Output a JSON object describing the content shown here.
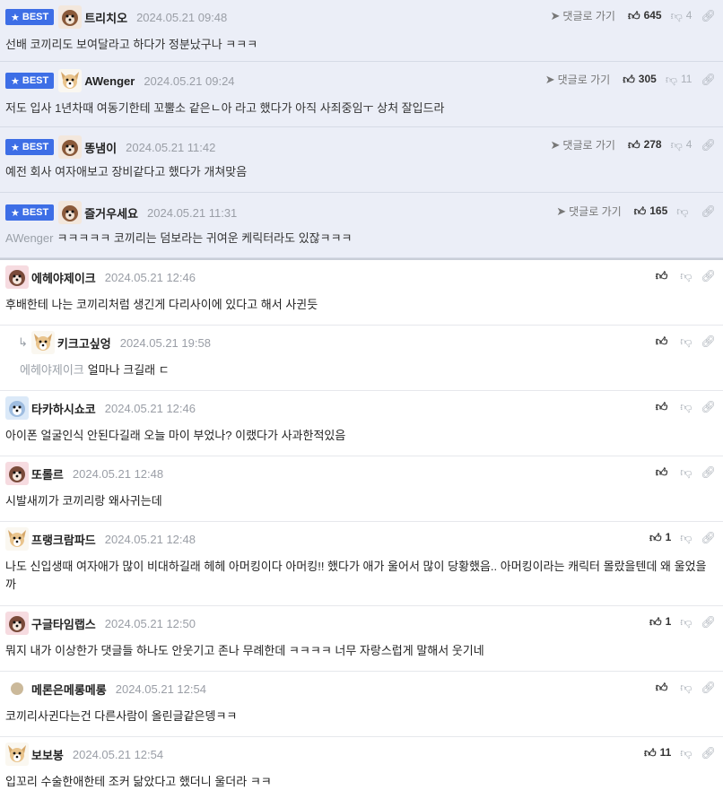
{
  "best_badge": "BEST",
  "goto_label": "댓글로 가기",
  "best_comments": [
    {
      "nick": "트리치오",
      "date": "2024.05.21 09:48",
      "text": "선배 코끼리도 보여달라고 하다가 정분났구나 ㅋㅋㅋ",
      "up": "645",
      "down": "4",
      "avatar": "dog-brown"
    },
    {
      "nick": "AWenger",
      "date": "2024.05.21 09:24",
      "text": "저도 입사 1년차때 여동기한테 꼬뿔소 같은ㄴ아 라고 했다가 아직 사죄중임ㅜ 상처 잘입드라",
      "up": "305",
      "down": "11",
      "avatar": "dog-tan"
    },
    {
      "nick": "똥냄이",
      "date": "2024.05.21 11:42",
      "text": "예전 회사 여자애보고 장비같다고 했다가 개쳐맞음",
      "up": "278",
      "down": "4",
      "avatar": "dog-brown"
    },
    {
      "nick": "즐거우세요",
      "date": "2024.05.21 11:31",
      "mention": "AWenger",
      "text": "ㅋㅋㅋㅋㅋ 코끼리는 덤보라는 귀여운 케릭터라도 있잖ㅋㅋㅋ",
      "up": "165",
      "down": "",
      "avatar": "dog-brown"
    }
  ],
  "comments": [
    {
      "nick": "에헤야제이크",
      "date": "2024.05.21 12:46",
      "text": "후배한테 나는 코끼리처럼 생긴게 다리사이에 있다고 해서 사귄듯",
      "up": "",
      "reply": false,
      "avatar": "dog-pink"
    },
    {
      "nick": "키크고싶엉",
      "date": "2024.05.21 19:58",
      "mention": "에헤야제이크",
      "text": "얼마나 크길래 ㄷ",
      "up": "",
      "reply": true,
      "avatar": "dog-tan"
    },
    {
      "nick": "타카하시쇼코",
      "date": "2024.05.21 12:46",
      "text": "아이폰 얼굴인식 안된다길래 오늘 마이 부었나? 이랬다가 사과한적있음",
      "up": "",
      "reply": false,
      "avatar": "dog-blue"
    },
    {
      "nick": "또롤르",
      "date": "2024.05.21 12:48",
      "text": "시발새끼가 코끼리랑 왜사귀는데",
      "up": "",
      "reply": false,
      "avatar": "dog-pink"
    },
    {
      "nick": "프랭크람파드",
      "date": "2024.05.21 12:48",
      "text": "나도 신입생때 여자애가 많이 비대하길래 헤헤 아머킹이다 아머킹!! 했다가 애가 울어서 많이 당황했음.. 아머킹이라는 캐릭터 몰랐을텐데 왜 울었을까",
      "up": "1",
      "reply": false,
      "avatar": "dog-tan"
    },
    {
      "nick": "구글타임랩스",
      "date": "2024.05.21 12:50",
      "text": "뭐지 내가 이상한가 댓글들 하나도 안웃기고 존나 무례한데 ㅋㅋㅋㅋ 너무 자랑스럽게 말해서 웃기네",
      "up": "1",
      "reply": false,
      "avatar": "dog-pink"
    },
    {
      "nick": "메론은메롱메롱",
      "date": "2024.05.21 12:54",
      "text": "코끼리사귄다는건 다른사람이 올린글같은뎅ㅋㅋ",
      "up": "",
      "reply": false,
      "avatar": "dot"
    },
    {
      "nick": "보보봉",
      "date": "2024.05.21 12:54",
      "text": "입꼬리 수술한애한테 조커 닮았다고 했더니 울더라 ㅋㅋ",
      "up": "11",
      "reply": false,
      "avatar": "dog-tan"
    }
  ],
  "colors": {
    "badge": "#3d6ee6",
    "best_bg": "#ebeef7"
  }
}
